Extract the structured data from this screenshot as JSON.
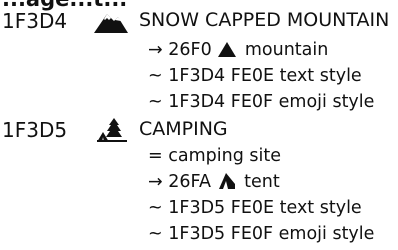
{
  "header_fragment": "...age...t...",
  "entries": [
    {
      "code": "1F3D4",
      "icon": "snow-capped-mountain-icon",
      "name": "SNOW CAPPED MOUNTAIN",
      "lines": [
        {
          "prefix": "→",
          "code": "26F0",
          "icon": "mountain-icon",
          "text": "mountain"
        },
        {
          "prefix": "~",
          "text": "1F3D4 FE0E  text style"
        },
        {
          "prefix": "~",
          "text": "1F3D4 FE0F  emoji style"
        }
      ]
    },
    {
      "code": "1F3D5",
      "icon": "camping-icon",
      "name": "CAMPING",
      "lines": [
        {
          "prefix": "=",
          "text": "camping site"
        },
        {
          "prefix": "→",
          "code": "26FA",
          "icon": "tent-icon",
          "text": "tent"
        },
        {
          "prefix": "~",
          "text": "1F3D5 FE0E  text style"
        },
        {
          "prefix": "~",
          "text": "1F3D5 FE0F  emoji style"
        }
      ]
    }
  ]
}
